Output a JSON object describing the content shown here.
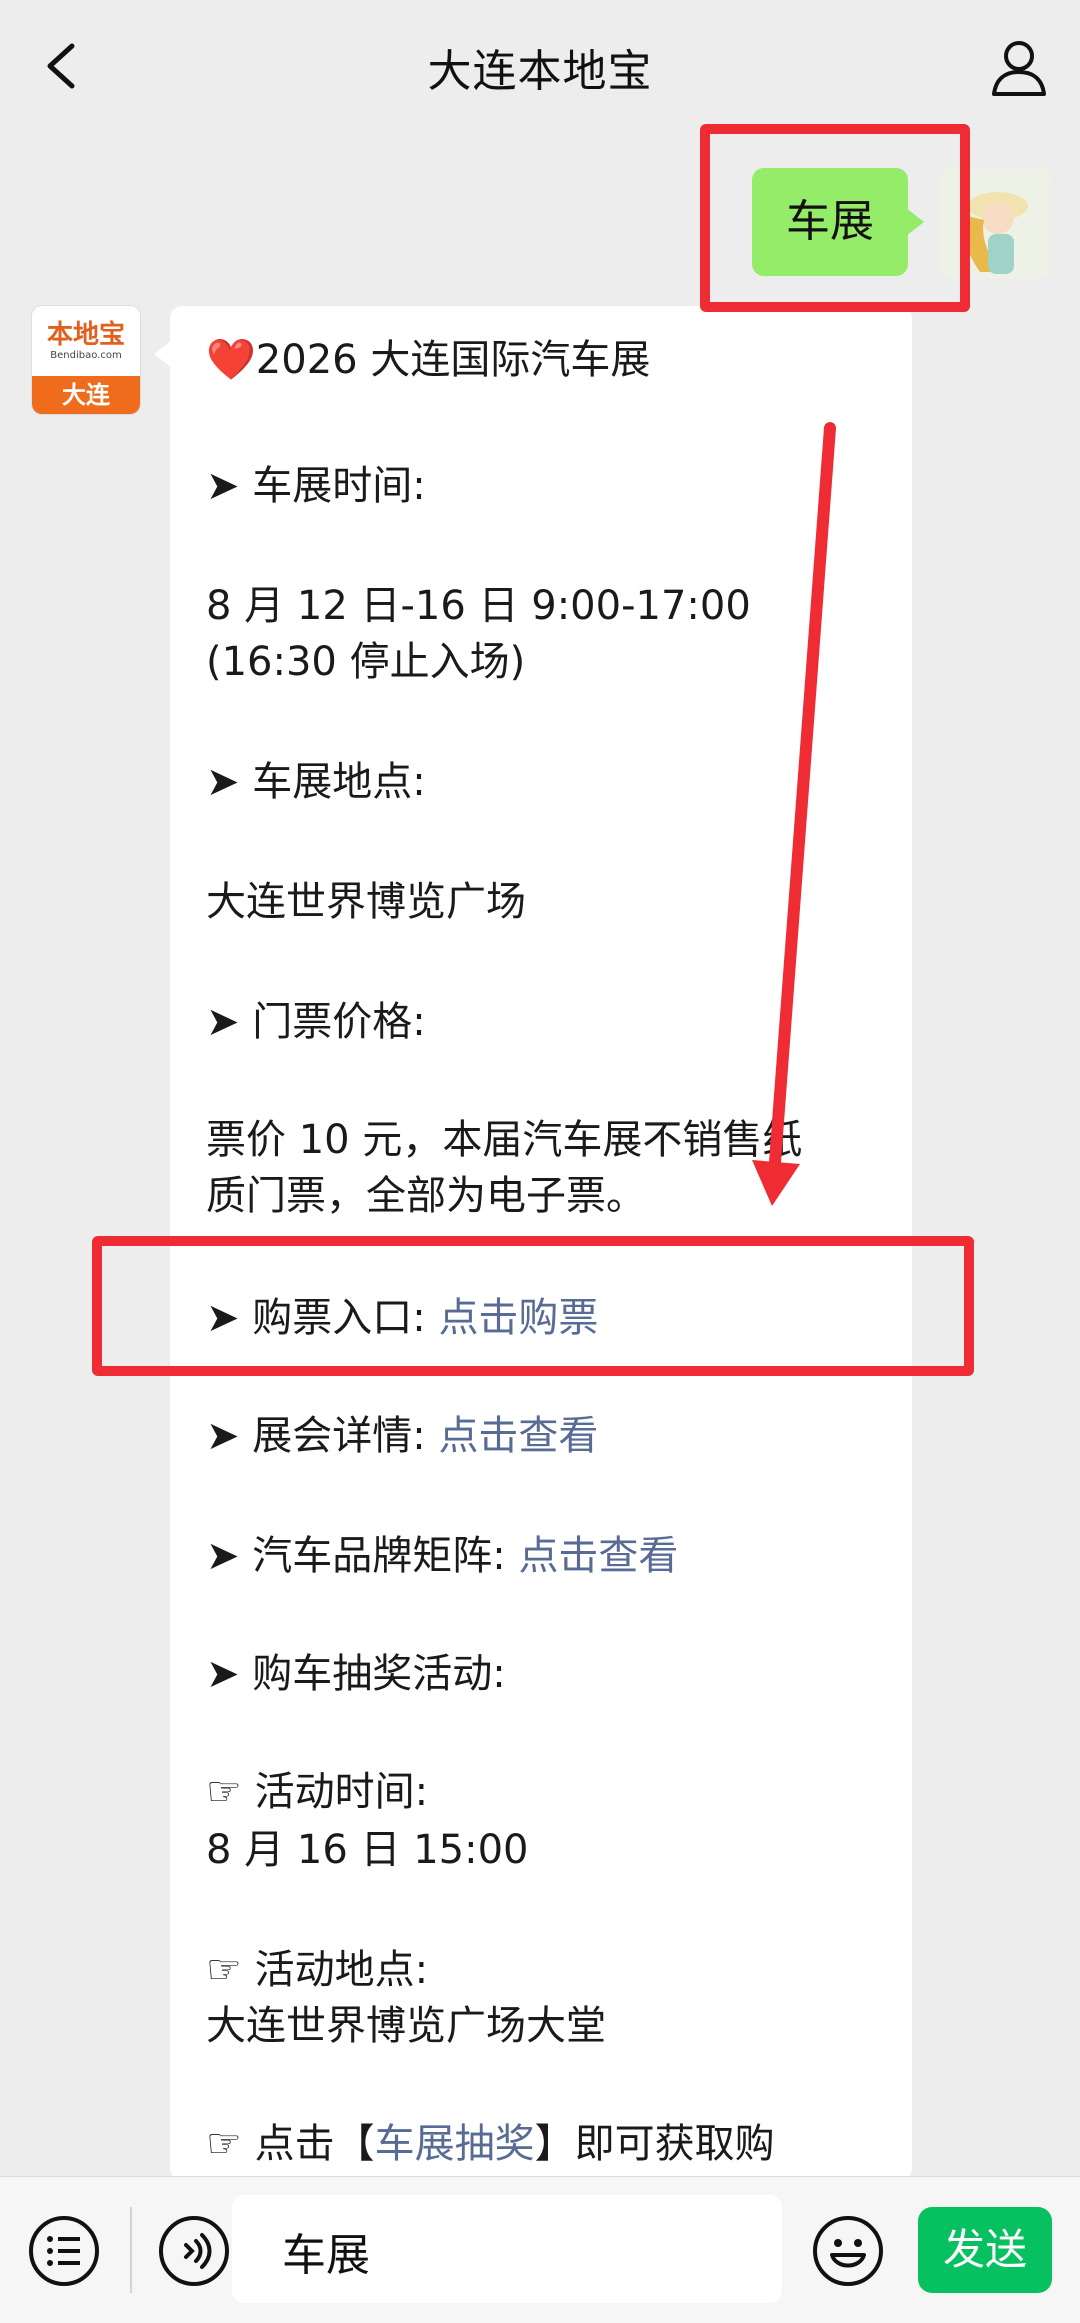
{
  "header": {
    "title": "大连本地宝"
  },
  "sent_message": {
    "text": "车展"
  },
  "bot_avatar": {
    "brand": "本地宝",
    "url": "Bendibao.com",
    "city": "大连"
  },
  "message": {
    "heading": "❤️2026 大连国际汽车展",
    "time_label": "➤ 车展时间:",
    "time_value_1": "8 月 12 日-16 日 9:00-17:00",
    "time_value_2": "(16:30 停止入场)",
    "location_label": "➤ 车展地点:",
    "location_value": "大连世界博览广场",
    "price_label": "➤ 门票价格:",
    "price_value_1": "票价 10 元，本届汽车展不销售纸",
    "price_value_2": "质门票，全部为电子票。",
    "ticket_label": "➤ 购票入口:",
    "ticket_link": "点击购票",
    "details_label": "➤ 展会详情:",
    "details_link": "点击查看",
    "brands_label": "➤ 汽车品牌矩阵:",
    "brands_link": "点击查看",
    "lottery_label": "➤ 购车抽奖活动:",
    "activity_time_label": "☞ 活动时间:",
    "activity_time_value": "8 月 16 日 15:00",
    "activity_place_label": "☞ 活动地点:",
    "activity_place_value": "大连世界博览广场大堂",
    "click_prefix": "☞ 点击【",
    "click_link": "车展抽奖",
    "click_suffix": "】即可获取购"
  },
  "input": {
    "value": "车展"
  },
  "send_button": {
    "label": "发送"
  },
  "colors": {
    "accent_green": "#07c160",
    "bubble_green": "#95ec69",
    "link_blue": "#576b95",
    "annotation_red": "#ef2b33"
  }
}
